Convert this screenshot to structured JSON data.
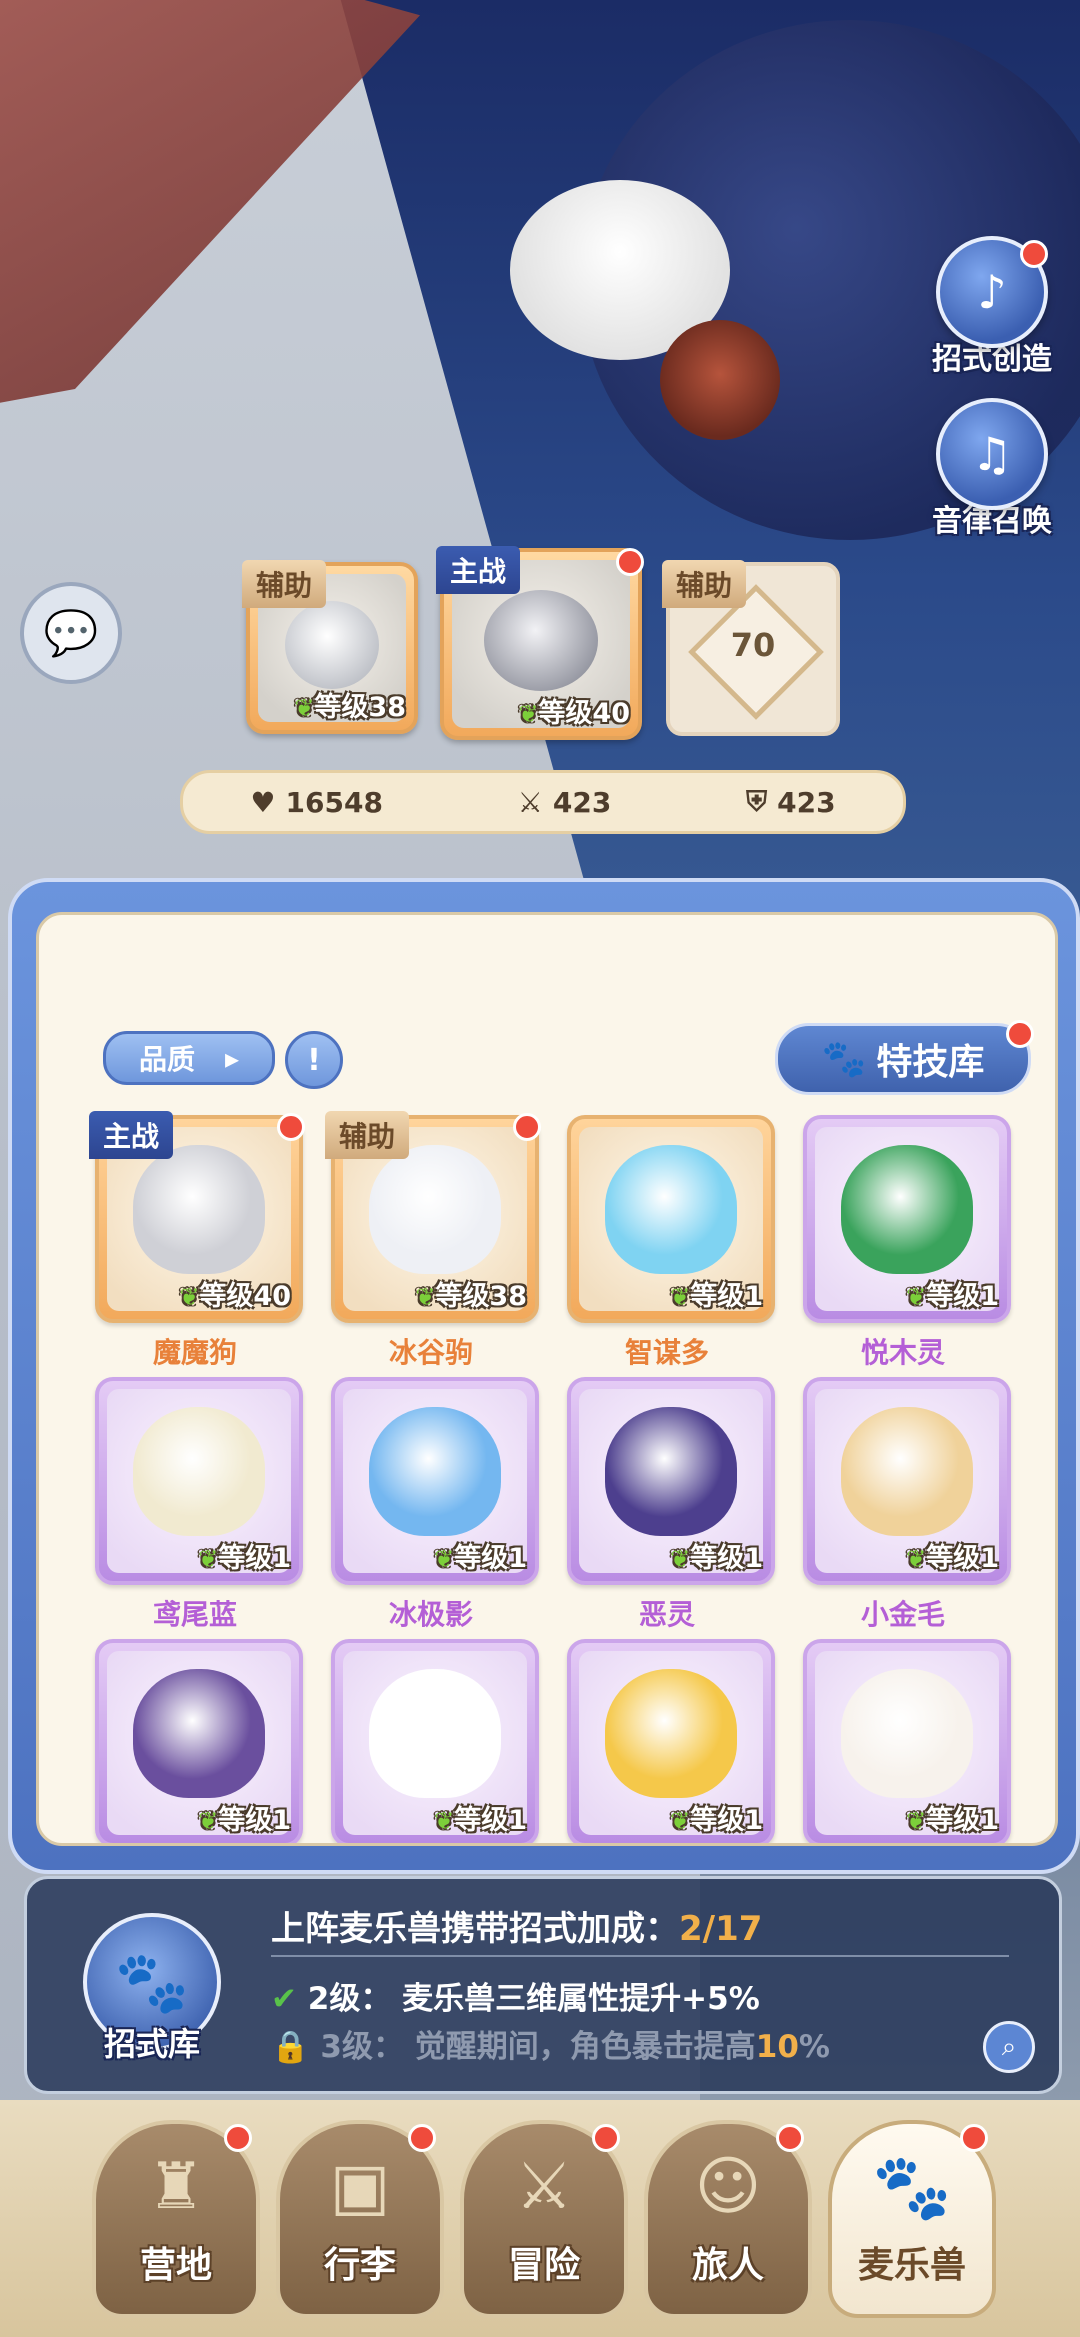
{
  "side_menu": {
    "skill_create": "招式创造",
    "rhythm_summon": "音律召唤"
  },
  "team": {
    "slot1": {
      "tag": "辅助",
      "level": "等级38"
    },
    "slot2": {
      "tag": "主战",
      "level": "等级40"
    },
    "slot3": {
      "tag": "辅助",
      "unlock_level": "70"
    }
  },
  "stats": {
    "hp": "16548",
    "attack": "423",
    "defense": "423"
  },
  "panel": {
    "quality_label": "品质",
    "filter_label": "!",
    "skill_library_label": "特技库"
  },
  "pets": [
    {
      "name": "魔魔狗",
      "level": "等级40",
      "tag": "主战",
      "rarity": "gold",
      "color": "#cfd0d6"
    },
    {
      "name": "冰谷驹",
      "level": "等级38",
      "tag": "辅助",
      "rarity": "gold",
      "color": "#eef0f5"
    },
    {
      "name": "智谋多",
      "level": "等级1",
      "tag": "",
      "rarity": "gold",
      "color": "#7fd3f2"
    },
    {
      "name": "悦木灵",
      "level": "等级1",
      "tag": "",
      "rarity": "purple",
      "color": "#3aa35c"
    },
    {
      "name": "鸢尾蓝",
      "level": "等级1",
      "tag": "",
      "rarity": "purple",
      "color": "#f1ead0"
    },
    {
      "name": "冰极影",
      "level": "等级1",
      "tag": "",
      "rarity": "purple",
      "color": "#74b7f0"
    },
    {
      "name": "恶灵",
      "level": "等级1",
      "tag": "",
      "rarity": "purple",
      "color": "#4d3f8e"
    },
    {
      "name": "小金毛",
      "level": "等级1",
      "tag": "",
      "rarity": "purple",
      "color": "#f0d29a"
    },
    {
      "name": "",
      "level": "等级1",
      "tag": "",
      "rarity": "purple",
      "color": "#6a4f9e"
    },
    {
      "name": "",
      "level": "等级1",
      "tag": "",
      "rarity": "purple",
      "color": "#ffffff"
    },
    {
      "name": "",
      "level": "等级1",
      "tag": "",
      "rarity": "purple",
      "color": "#f5c84a"
    },
    {
      "name": "",
      "level": "等级1",
      "tag": "",
      "rarity": "purple",
      "color": "#f7f2ec"
    }
  ],
  "info": {
    "icon_label": "招式库",
    "title": "上阵麦乐兽携带招式加成：",
    "count": "2/17",
    "line1_level": "2级：",
    "line1_text": "麦乐兽三维属性提升+5%",
    "line2_level": "3级：",
    "line2_text_a": "觉醒期间，角色暴击提高",
    "line2_highlight": "10",
    "line2_text_b": "%"
  },
  "nav": [
    {
      "label": "营地",
      "icon": "castle-icon"
    },
    {
      "label": "行李",
      "icon": "backpack-icon"
    },
    {
      "label": "冒险",
      "icon": "swords-icon"
    },
    {
      "label": "旅人",
      "icon": "traveler-icon"
    },
    {
      "label": "麦乐兽",
      "icon": "pet-icon"
    }
  ]
}
